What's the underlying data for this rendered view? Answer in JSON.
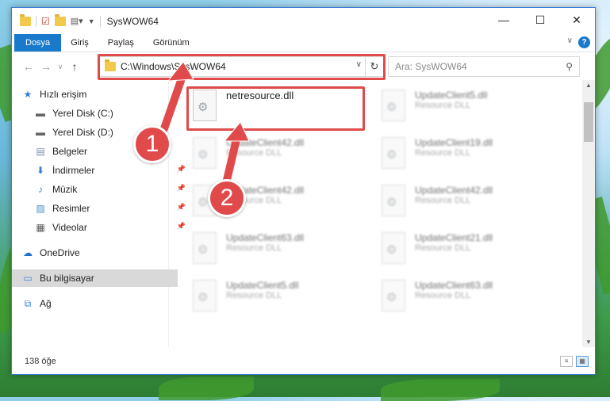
{
  "window": {
    "title": "SysWOW64",
    "controls": {
      "minimize": "—",
      "maximize": "☐",
      "close": "✕"
    }
  },
  "ribbon": {
    "tabs": [
      "Dosya",
      "Giriş",
      "Paylaş",
      "Görünüm"
    ],
    "help": "?"
  },
  "navigation": {
    "address": "C:\\Windows\\SysWOW64",
    "search_placeholder": "Ara: SysWOW64"
  },
  "sidebar": {
    "items": [
      {
        "label": "Hızlı erişim",
        "icon": "star-icon"
      },
      {
        "label": "Yerel Disk (C:)",
        "icon": "drive-icon"
      },
      {
        "label": "Yerel Disk (D:)",
        "icon": "drive-icon"
      },
      {
        "label": "Belgeler",
        "icon": "documents-icon"
      },
      {
        "label": "İndirmeler",
        "icon": "download-icon"
      },
      {
        "label": "Müzik",
        "icon": "music-icon"
      },
      {
        "label": "Resimler",
        "icon": "pictures-icon"
      },
      {
        "label": "Videolar",
        "icon": "video-icon"
      },
      {
        "label": "OneDrive",
        "icon": "cloud-icon"
      },
      {
        "label": "Bu bilgisayar",
        "icon": "computer-icon"
      },
      {
        "label": "Ağ",
        "icon": "network-icon"
      }
    ]
  },
  "files": {
    "highlighted": {
      "name": "netresource.dll"
    },
    "items": [
      {
        "name": "UpdateClient5.dll",
        "type": "Resource DLL"
      },
      {
        "name": "UpdateClient42.dll",
        "type": "Resource DLL"
      },
      {
        "name": "UpdateClient19.dll",
        "type": "Resource DLL"
      },
      {
        "name": "UpdateClient42.dll",
        "type": "Resource DLL"
      },
      {
        "name": "UpdateClient42.dll",
        "type": "Resource DLL"
      },
      {
        "name": "UpdateClient63.dll",
        "type": "Resource DLL"
      },
      {
        "name": "UpdateClient21.dll",
        "type": "Resource DLL"
      },
      {
        "name": "UpdateClient5.dll",
        "type": "Resource DLL"
      },
      {
        "name": "UpdateClient63.dll",
        "type": "Resource DLL"
      }
    ]
  },
  "status": {
    "count": "138 öğe"
  },
  "callouts": [
    "1",
    "2"
  ],
  "colors": {
    "accent": "#1979ca",
    "highlight": "#e04a4a"
  }
}
